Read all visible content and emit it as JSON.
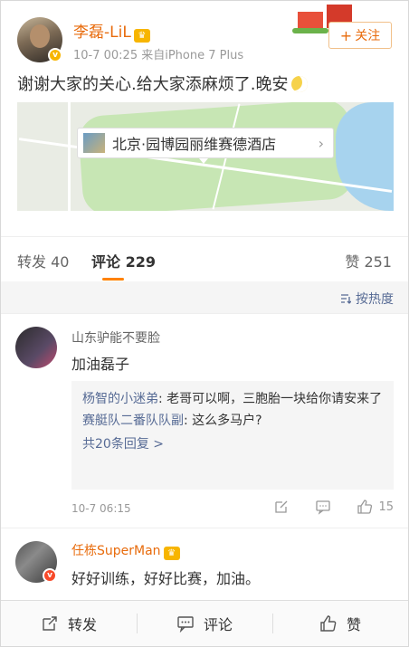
{
  "post": {
    "username": "李磊-LiL",
    "meta": "10-7 00:25  来自iPhone 7 Plus",
    "follow_label": "关注",
    "text": "谢谢大家的关心.给大家添麻烦了.晚安",
    "location": "北京·园博园丽维赛德酒店"
  },
  "tabs": {
    "repost": "转发 40",
    "comment": "评论 229",
    "like": "赞 251"
  },
  "sort": {
    "label": "按热度"
  },
  "comments": [
    {
      "username": "山东驴能不要脸",
      "text": "加油磊子",
      "replies": [
        {
          "name": "杨智的小迷弟",
          "text": ": 老哥可以啊，三胞胎一块给你请安来了"
        },
        {
          "name": "赛艇队二番队队副",
          "text": ": 这么多马户?"
        }
      ],
      "more_replies": "共20条回复 >",
      "time": "10-7 06:15",
      "likes": "15"
    },
    {
      "username": "任栋SuperMan",
      "text": "好好训练，好好比赛，加油。"
    }
  ],
  "bottom_bar": {
    "repost": "转发",
    "comment": "评论",
    "like": "赞"
  },
  "colors": {
    "accent_orange": "#ff8200",
    "username_orange": "#e86b0c",
    "link_blue": "#576b95"
  }
}
